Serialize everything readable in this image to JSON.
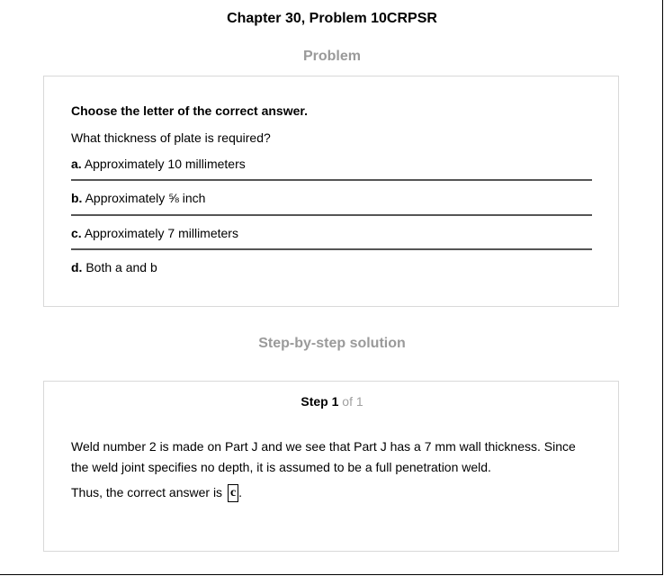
{
  "header": {
    "title": "Chapter 30, Problem 10CRPSR"
  },
  "problem": {
    "heading": "Problem",
    "instruction": "Choose the letter of the correct answer.",
    "question": "What thickness of plate is required?",
    "options": [
      {
        "letter": "a.",
        "text": "Approximately 10 millimeters"
      },
      {
        "letter": "b.",
        "text": "Approximately ⅝ inch"
      },
      {
        "letter": "c.",
        "text": "Approximately 7 millimeters"
      },
      {
        "letter": "d.",
        "text": "Both a and b"
      }
    ]
  },
  "solution": {
    "heading": "Step-by-step solution",
    "step_word": "Step",
    "step_number": "1",
    "step_of": "of 1",
    "explanation": "Weld number 2 is made on Part J and we see that Part J has a 7 mm wall thickness. Since the weld joint specifies no depth, it is assumed to be a full penetration weld.",
    "answer_prefix": "Thus, the correct answer is",
    "answer_value": "c",
    "answer_suffix": "."
  }
}
